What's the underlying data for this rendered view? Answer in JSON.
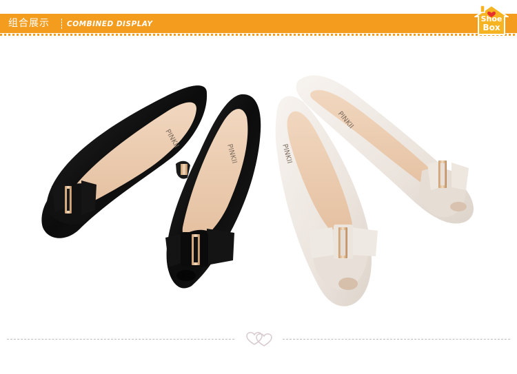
{
  "header": {
    "title_cn": "组合展示",
    "title_en": "COMBINED DISPLAY",
    "bar_color": "#f39c1e"
  },
  "logo": {
    "line1": "Shoe",
    "line2": "Box",
    "icon": "house-heart-icon"
  },
  "product": {
    "brand_imprint": "PINKII"
  },
  "footer": {
    "icon": "double-heart-icon"
  }
}
